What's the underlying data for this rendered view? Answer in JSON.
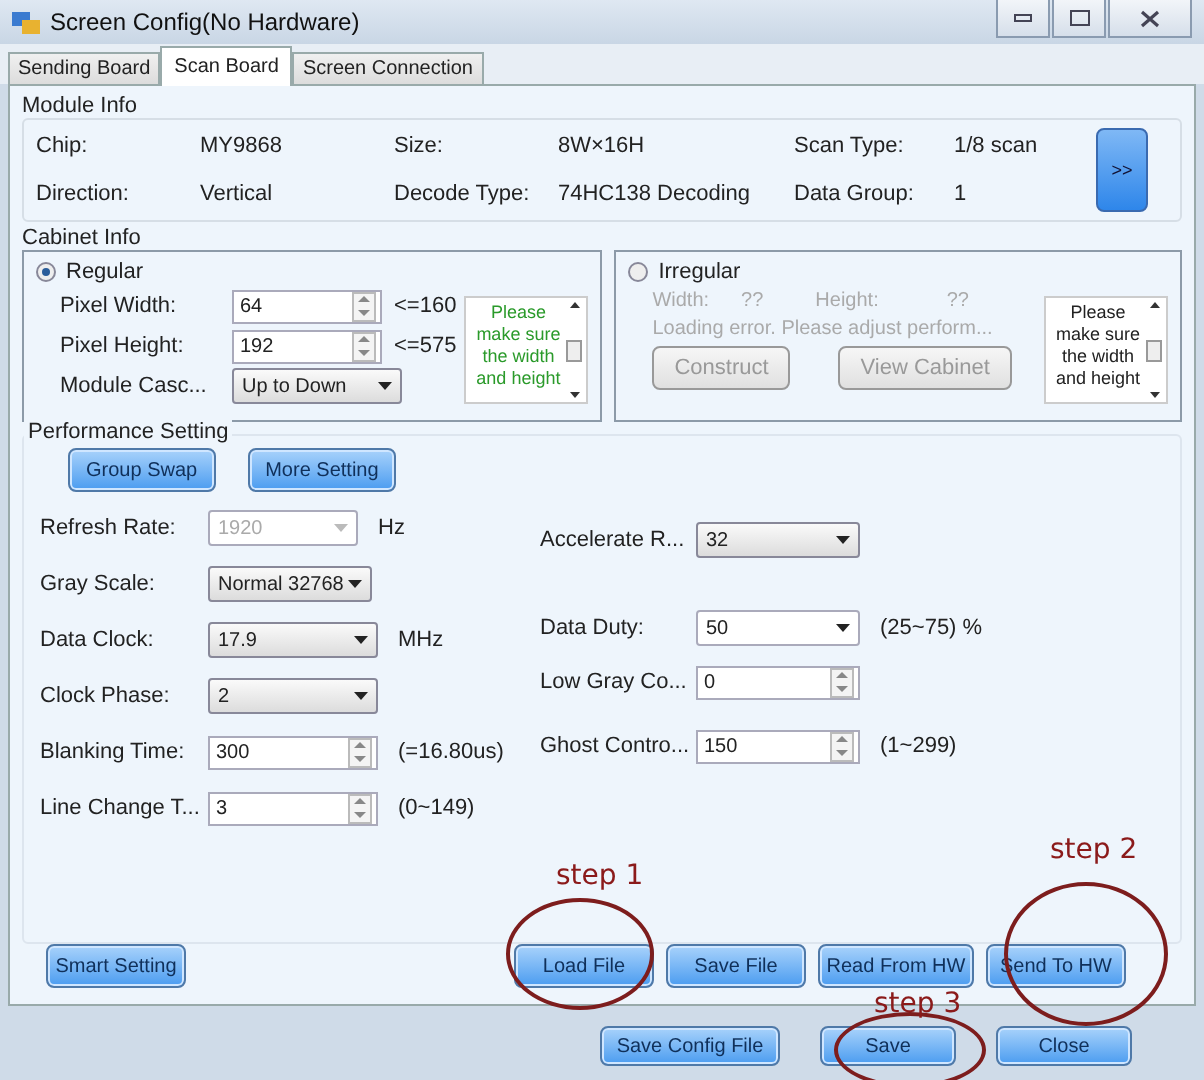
{
  "window": {
    "title": "Screen Config(No Hardware)"
  },
  "tabs": [
    {
      "label": "Sending Board",
      "selected": false
    },
    {
      "label": "Scan Board",
      "selected": true
    },
    {
      "label": "Screen Connection",
      "selected": false
    }
  ],
  "module_info": {
    "title": "Module Info",
    "fields": [
      {
        "label": "Chip:",
        "value": "MY9868"
      },
      {
        "label": "Size:",
        "value": "8W×16H"
      },
      {
        "label": "Scan Type:",
        "value": "1/8 scan"
      },
      {
        "label": "Direction:",
        "value": "Vertical"
      },
      {
        "label": "Decode Type:",
        "value": "74HC138 Decoding"
      },
      {
        "label": "Data Group:",
        "value": "1"
      }
    ],
    "expand_button": ">>"
  },
  "cabinet_info": {
    "title": "Cabinet Info",
    "regular": {
      "label": "Regular",
      "selected": true,
      "rows": [
        {
          "label": "Pixel Width:",
          "kind": "spinner",
          "value": "64",
          "hint": "<=160"
        },
        {
          "label": "Pixel Height:",
          "kind": "spinner",
          "value": "192",
          "hint": "<=575"
        },
        {
          "label": "Module Casc...",
          "kind": "dropdown",
          "value": "Up to Down"
        }
      ],
      "note": "Please make sure the width and height"
    },
    "irregular": {
      "label": "Irregular",
      "selected": false,
      "width_label": "Width:",
      "width_value": "??",
      "height_label": "Height:",
      "height_value": "??",
      "message": "Loading error. Please adjust perform...",
      "buttons": [
        "Construct",
        "View Cabinet"
      ],
      "note": "Please make sure the width and height"
    }
  },
  "performance": {
    "title": "Performance Setting",
    "top_buttons": [
      "Group Swap",
      "More Setting"
    ],
    "left": [
      {
        "label": "Refresh Rate:",
        "kind": "dropdown",
        "value": "1920",
        "disabled": true,
        "unit": "Hz"
      },
      {
        "label": "Gray Scale:",
        "kind": "dropdown",
        "value": "Normal 32768",
        "disabled": false
      },
      {
        "label": "Data Clock:",
        "kind": "dropdown",
        "value": "17.9",
        "disabled": false,
        "unit": "MHz"
      },
      {
        "label": "Clock Phase:",
        "kind": "dropdown",
        "value": "2",
        "disabled": false
      },
      {
        "label": "Blanking Time:",
        "kind": "spinner",
        "value": "300",
        "disabled": false,
        "unit": "(=16.80us)"
      },
      {
        "label": "Line Change T...",
        "kind": "spinner",
        "value": "3",
        "disabled": false,
        "unit": "(0~149)"
      }
    ],
    "right": [
      {
        "label": "Accelerate R...",
        "kind": "dropdown",
        "value": "32",
        "disabled": false
      },
      {
        "label": "Data Duty:",
        "kind": "dropdown",
        "value": "50",
        "disabled": false,
        "unit": "(25~75) %"
      },
      {
        "label": "Low Gray Co...",
        "kind": "spinner",
        "value": "0",
        "disabled": false
      },
      {
        "label": "Ghost Contro...",
        "kind": "spinner",
        "value": "150",
        "disabled": false,
        "unit": "(1~299)"
      }
    ]
  },
  "action_buttons": [
    "Smart Setting",
    "Load File",
    "Save File",
    "Read From HW",
    "Send To HW"
  ],
  "footer_buttons": [
    "Save Config File",
    "Save",
    "Close"
  ],
  "annotations": [
    {
      "text": "step 1"
    },
    {
      "text": "step 2"
    },
    {
      "text": "step 3"
    }
  ]
}
